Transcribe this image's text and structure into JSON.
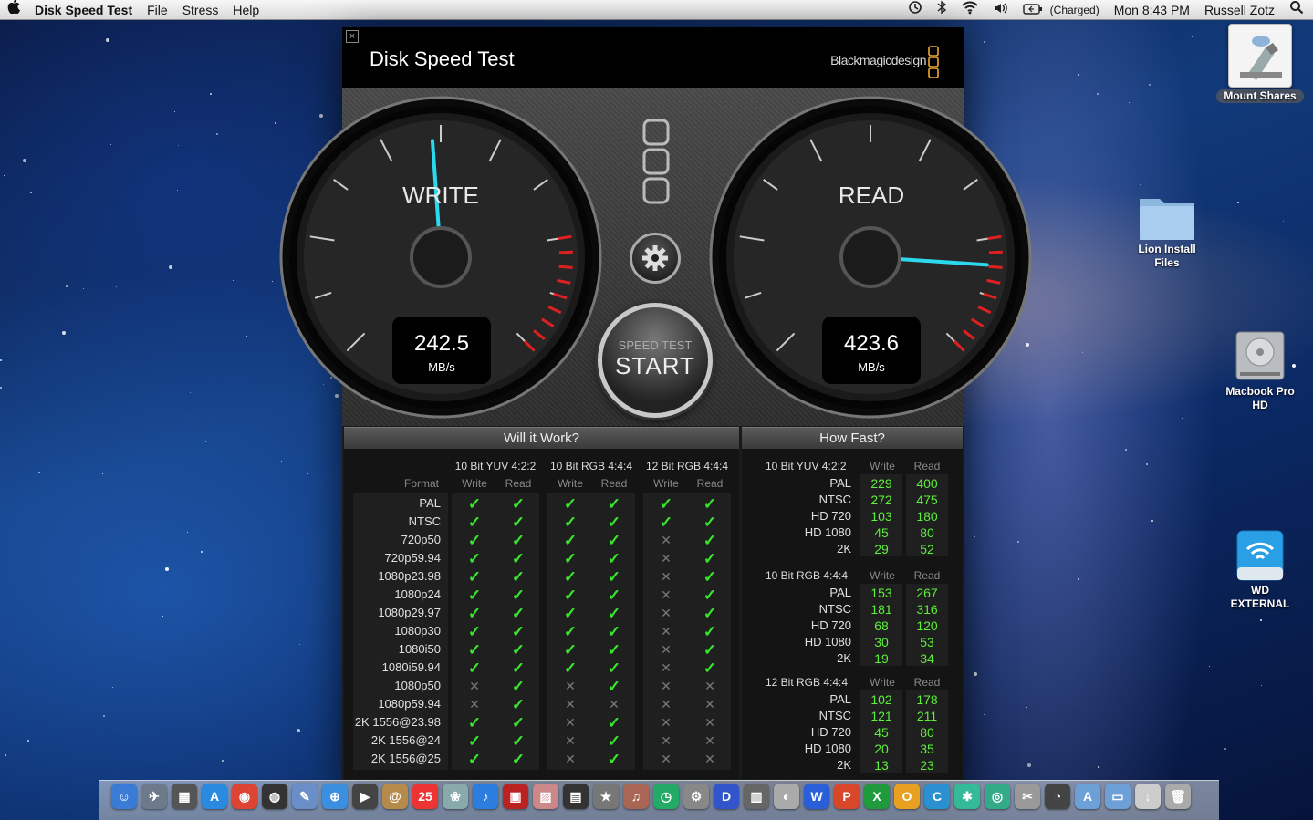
{
  "menubar": {
    "app_name": "Disk Speed Test",
    "menus": [
      "File",
      "Stress",
      "Help"
    ],
    "battery_status": "(Charged)",
    "clock": "Mon 8:43 PM",
    "user": "Russell Zotz",
    "icons": [
      "apple-icon",
      "time-machine-icon",
      "bluetooth-icon",
      "wifi-icon",
      "volume-icon",
      "battery-icon",
      "spotlight-icon"
    ]
  },
  "desktop": {
    "icons": [
      {
        "label": "Mount Shares",
        "icon": "mount-shares-icon"
      },
      {
        "label": "Lion Install Files",
        "icon": "folder-icon"
      },
      {
        "label": "Macbook Pro HD",
        "icon": "hard-drive-icon"
      },
      {
        "label": "WD EXTERNAL",
        "icon": "external-drive-icon"
      }
    ]
  },
  "window": {
    "title": "Disk Speed Test",
    "brand": "Blackmagicdesign",
    "close_glyph": "×",
    "write_gauge": {
      "label": "WRITE",
      "value": "242.5",
      "unit": "MB/s",
      "needle_value": 242.5
    },
    "read_gauge": {
      "label": "READ",
      "value": "423.6",
      "unit": "MB/s",
      "needle_value": 423.6
    },
    "start_button": {
      "top": "SPEED TEST",
      "main": "START"
    },
    "settings_icon": "gear-icon"
  },
  "will_it_work": {
    "title": "Will it Work?",
    "format_label": "Format",
    "groups": [
      "10 Bit YUV 4:2:2",
      "10 Bit RGB 4:4:4",
      "12 Bit RGB 4:4:4"
    ],
    "sub_headers": [
      "Write",
      "Read"
    ],
    "rows": [
      {
        "format": "PAL",
        "results": [
          1,
          1,
          1,
          1,
          1,
          1
        ]
      },
      {
        "format": "NTSC",
        "results": [
          1,
          1,
          1,
          1,
          1,
          1
        ]
      },
      {
        "format": "720p50",
        "results": [
          1,
          1,
          1,
          1,
          0,
          1
        ]
      },
      {
        "format": "720p59.94",
        "results": [
          1,
          1,
          1,
          1,
          0,
          1
        ]
      },
      {
        "format": "1080p23.98",
        "results": [
          1,
          1,
          1,
          1,
          0,
          1
        ]
      },
      {
        "format": "1080p24",
        "results": [
          1,
          1,
          1,
          1,
          0,
          1
        ]
      },
      {
        "format": "1080p29.97",
        "results": [
          1,
          1,
          1,
          1,
          0,
          1
        ]
      },
      {
        "format": "1080p30",
        "results": [
          1,
          1,
          1,
          1,
          0,
          1
        ]
      },
      {
        "format": "1080i50",
        "results": [
          1,
          1,
          1,
          1,
          0,
          1
        ]
      },
      {
        "format": "1080i59.94",
        "results": [
          1,
          1,
          1,
          1,
          0,
          1
        ]
      },
      {
        "format": "1080p50",
        "results": [
          0,
          1,
          0,
          1,
          0,
          0
        ]
      },
      {
        "format": "1080p59.94",
        "results": [
          0,
          1,
          0,
          0,
          0,
          0
        ]
      },
      {
        "format": "2K 1556@23.98",
        "results": [
          1,
          1,
          0,
          1,
          0,
          0
        ]
      },
      {
        "format": "2K 1556@24",
        "results": [
          1,
          1,
          0,
          1,
          0,
          0
        ]
      },
      {
        "format": "2K 1556@25",
        "results": [
          1,
          1,
          0,
          1,
          0,
          0
        ]
      }
    ]
  },
  "how_fast": {
    "title": "How Fast?",
    "write_label": "Write",
    "read_label": "Read",
    "groups": [
      {
        "name": "10 Bit YUV 4:2:2",
        "rows": [
          {
            "format": "PAL",
            "write": "229",
            "read": "400"
          },
          {
            "format": "NTSC",
            "write": "272",
            "read": "475"
          },
          {
            "format": "HD 720",
            "write": "103",
            "read": "180"
          },
          {
            "format": "HD 1080",
            "write": "45",
            "read": "80"
          },
          {
            "format": "2K",
            "write": "29",
            "read": "52"
          }
        ]
      },
      {
        "name": "10 Bit RGB 4:4:4",
        "rows": [
          {
            "format": "PAL",
            "write": "153",
            "read": "267"
          },
          {
            "format": "NTSC",
            "write": "181",
            "read": "316"
          },
          {
            "format": "HD 720",
            "write": "68",
            "read": "120"
          },
          {
            "format": "HD 1080",
            "write": "30",
            "read": "53"
          },
          {
            "format": "2K",
            "write": "19",
            "read": "34"
          }
        ]
      },
      {
        "name": "12 Bit RGB 4:4:4",
        "rows": [
          {
            "format": "PAL",
            "write": "102",
            "read": "178"
          },
          {
            "format": "NTSC",
            "write": "121",
            "read": "211"
          },
          {
            "format": "HD 720",
            "write": "45",
            "read": "80"
          },
          {
            "format": "HD 1080",
            "write": "20",
            "read": "35"
          },
          {
            "format": "2K",
            "write": "13",
            "read": "23"
          }
        ]
      }
    ]
  },
  "dock": {
    "items": [
      {
        "name": "finder",
        "glyph": "☺",
        "color": "#3a7bd5"
      },
      {
        "name": "launchpad",
        "glyph": "✈",
        "color": "#6c7a8a"
      },
      {
        "name": "mission-control",
        "glyph": "▦",
        "color": "#555"
      },
      {
        "name": "app-store",
        "glyph": "A",
        "color": "#2a8ae0"
      },
      {
        "name": "chrome",
        "glyph": "◉",
        "color": "#d43"
      },
      {
        "name": "dashboard",
        "glyph": "◍",
        "color": "#333"
      },
      {
        "name": "preview",
        "glyph": "✎",
        "color": "#6a8fc8"
      },
      {
        "name": "safari",
        "glyph": "⊕",
        "color": "#3b8fe0"
      },
      {
        "name": "facetime",
        "glyph": "▶",
        "color": "#444"
      },
      {
        "name": "contacts",
        "glyph": "@",
        "color": "#b58a4a"
      },
      {
        "name": "calendar",
        "glyph": "25",
        "color": "#e33"
      },
      {
        "name": "photos",
        "glyph": "❀",
        "color": "#8aa"
      },
      {
        "name": "itunes",
        "glyph": "♪",
        "color": "#2b7de0"
      },
      {
        "name": "photo-booth",
        "glyph": "▣",
        "color": "#b22"
      },
      {
        "name": "iphoto",
        "glyph": "▨",
        "color": "#c88"
      },
      {
        "name": "clapper",
        "glyph": "▤",
        "color": "#333"
      },
      {
        "name": "imovie",
        "glyph": "★",
        "color": "#777"
      },
      {
        "name": "garageband",
        "glyph": "♫",
        "color": "#a65"
      },
      {
        "name": "time-machine",
        "glyph": "◷",
        "color": "#2a6"
      },
      {
        "name": "system-preferences",
        "glyph": "⚙",
        "color": "#888"
      },
      {
        "name": "vlc",
        "glyph": "D",
        "color": "#35c"
      },
      {
        "name": "utilities",
        "glyph": "▥",
        "color": "#666"
      },
      {
        "name": "cleanup",
        "glyph": "◐",
        "color": "#aaa"
      },
      {
        "name": "word",
        "glyph": "W",
        "color": "#2b5fd9"
      },
      {
        "name": "powerpoint",
        "glyph": "P",
        "color": "#d9472b"
      },
      {
        "name": "excel",
        "glyph": "X",
        "color": "#1f9a3d"
      },
      {
        "name": "outlook",
        "glyph": "O",
        "color": "#e8a020"
      },
      {
        "name": "communicator",
        "glyph": "C",
        "color": "#2a90d0"
      },
      {
        "name": "messenger",
        "glyph": "✱",
        "color": "#3b9"
      },
      {
        "name": "network",
        "glyph": "◎",
        "color": "#3a8"
      },
      {
        "name": "tools",
        "glyph": "✂",
        "color": "#999"
      },
      {
        "name": "disk-utility",
        "glyph": "◔",
        "color": "#444"
      },
      {
        "name": "applications-folder",
        "glyph": "A",
        "color": "#6ea0d8"
      },
      {
        "name": "documents-folder",
        "glyph": "▭",
        "color": "#6ea0d8"
      },
      {
        "name": "downloads-folder",
        "glyph": "↓",
        "color": "#ccc"
      },
      {
        "name": "trash",
        "glyph": "🗑",
        "color": "#aaa"
      }
    ]
  }
}
